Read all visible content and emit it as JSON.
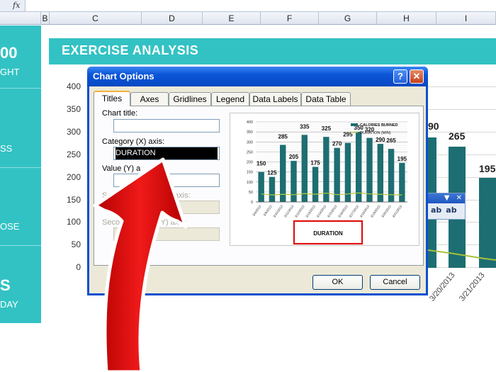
{
  "formula_bar": {
    "fx": "fx"
  },
  "columns": [
    "B",
    "C",
    "D",
    "E",
    "F",
    "G",
    "H",
    "I"
  ],
  "dashboard": {
    "title": "EXERCISE ANALYSIS",
    "sidebar_fragments": [
      "00",
      "GHT",
      "SS",
      "OSE",
      "S",
      "DAY"
    ],
    "y_ticks": [
      "400",
      "350",
      "300",
      "250",
      "200",
      "150",
      "100",
      "50",
      "0"
    ],
    "bg_bar_labels": [
      "90",
      "265",
      "195"
    ],
    "x_dates": [
      "3/20/2013",
      "3/21/2013"
    ],
    "accent": "#33c2c4",
    "bar_color": "#1d6e72"
  },
  "mini_toolbar": {
    "dropdown": "▼",
    "close": "✕",
    "btn1": "ab",
    "btn2": "ab"
  },
  "dialog": {
    "title": "Chart Options",
    "help": "?",
    "close": "✕",
    "tabs": [
      "Titles",
      "Axes",
      "Gridlines",
      "Legend",
      "Data Labels",
      "Data Table"
    ],
    "active_tab": "Titles",
    "fields": {
      "chart_title_label": "Chart title:",
      "chart_title_value": "",
      "category_x_label": "Category (X) axis:",
      "category_x_value": "DURATION",
      "value_y_label": "Value (Y) a",
      "value_y_value": "",
      "second_cat_label": "S",
      "second_cat_label_tail": "y axis:",
      "second_val_label": "Second",
      "second_val_label_tail": "le (Y) axis:"
    },
    "ok_label": "OK",
    "cancel_label": "Cancel"
  },
  "preview": {
    "legend": [
      "CALORIES BURNED",
      "DURATION (MIN)"
    ],
    "highlight_label": "DURATION"
  },
  "chart_data": {
    "type": "bar",
    "categories": [
      "3/8",
      "3/9",
      "3/10",
      "3/11",
      "3/12",
      "3/13",
      "3/14",
      "3/15",
      "3/16",
      "3/17",
      "3/18",
      "3/19",
      "3/20",
      "3/21"
    ],
    "series": [
      {
        "name": "CALORIES BURNED",
        "values": [
          150,
          125,
          285,
          205,
          335,
          175,
          325,
          270,
          295,
          350,
          320,
          290,
          265,
          195
        ]
      },
      {
        "name": "DURATION (MIN)",
        "values": [
          40,
          35,
          38,
          36,
          42,
          38,
          44,
          36,
          40,
          45,
          40,
          38,
          36,
          35
        ]
      }
    ],
    "ylim": [
      0,
      400
    ],
    "y_ticks": [
      0,
      50,
      100,
      150,
      200,
      250,
      300,
      350,
      400
    ],
    "xlabel": "DURATION",
    "legend_position": "top-right"
  }
}
